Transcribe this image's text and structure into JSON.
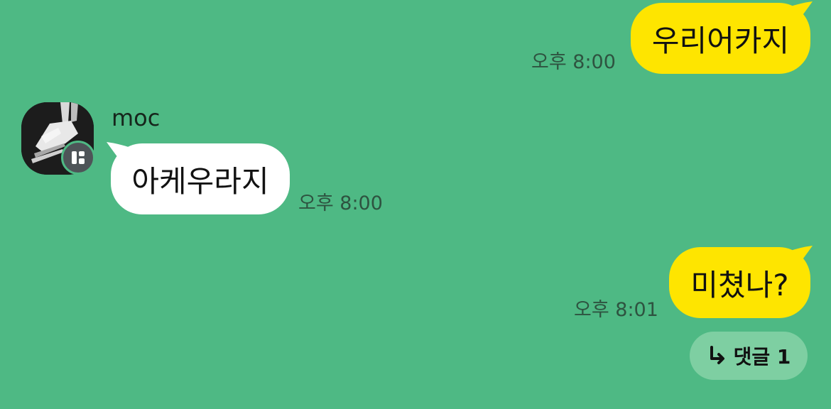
{
  "colors": {
    "background": "#4EB984",
    "my_bubble": "#FEE500",
    "their_bubble": "#FFFFFF",
    "time_text": "#2E5340",
    "reply_pill": "#7ECFA2"
  },
  "messages": [
    {
      "direction": "outgoing",
      "text": "우리어카지",
      "time": "오후 8:00"
    },
    {
      "direction": "incoming",
      "sender": "moc",
      "text": "아케우라지",
      "time": "오후 8:00"
    },
    {
      "direction": "outgoing",
      "text": "미쳤나?",
      "time": "오후 8:01"
    }
  ],
  "reply": {
    "icon": "reply-arrow-icon",
    "label": "댓글 1"
  }
}
